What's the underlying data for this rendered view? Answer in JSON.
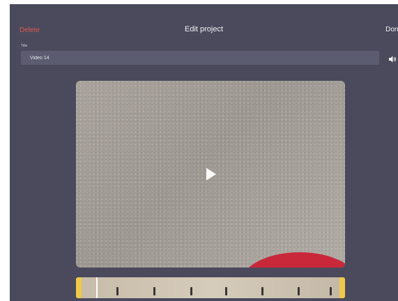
{
  "header": {
    "delete_label": "Delete",
    "title": "Edit project",
    "done_label": "Done"
  },
  "form": {
    "title_label": "Title",
    "title_value": "Video 14"
  },
  "colors": {
    "background": "#4a4a5c",
    "delete": "#e0574f",
    "trim_handles": "#f0c94a"
  },
  "icons": {
    "audio": "speaker-icon",
    "play": "play-icon"
  }
}
